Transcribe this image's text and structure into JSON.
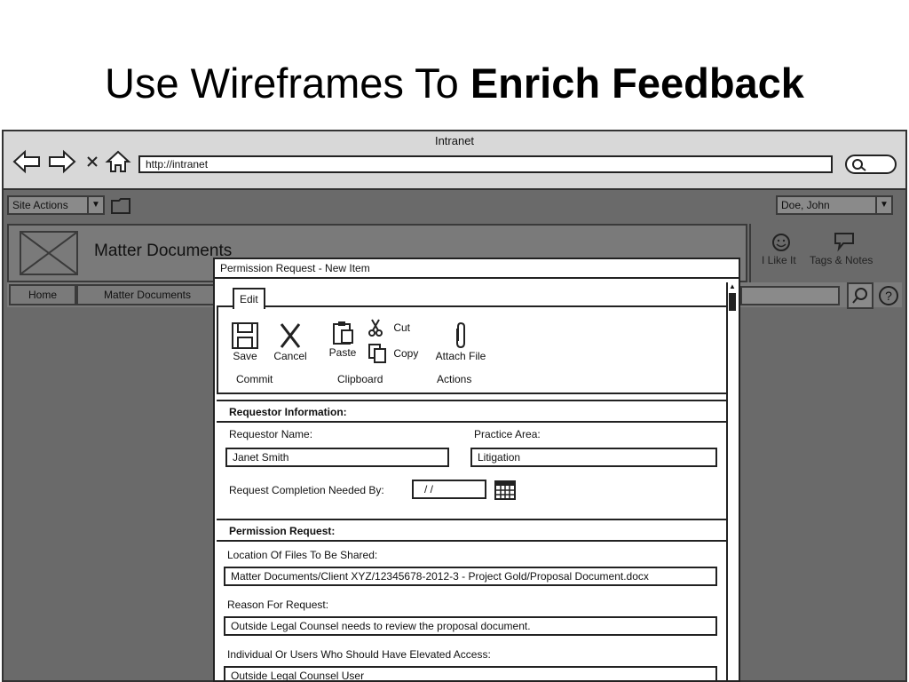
{
  "slide": {
    "title_plain": "Use Wireframes To ",
    "title_bold": "Enrich Feedback"
  },
  "browser": {
    "window_title": "Intranet",
    "url": "http://intranet"
  },
  "page": {
    "site_actions": "Site Actions",
    "user": "Doe, John",
    "site_name": "Matter Documents",
    "like_label": "I Like It",
    "tags_label": "Tags & Notes",
    "nav": [
      "Home",
      "Matter Documents"
    ]
  },
  "dialog": {
    "title": "Permission Request - New Item",
    "tab": "Edit",
    "buttons": {
      "save": "Save",
      "cancel": "Cancel",
      "paste": "Paste",
      "cut": "Cut",
      "copy": "Copy",
      "attach": "Attach File"
    },
    "groups": {
      "commit": "Commit",
      "clipboard": "Clipboard",
      "actions": "Actions"
    },
    "requestor_section": "Requestor Information:",
    "requestor_name_label": "Requestor Name:",
    "requestor_name_value": "Janet Smith",
    "practice_area_label": "Practice Area:",
    "practice_area_value": "Litigation",
    "completion_label": "Request Completion Needed By:",
    "completion_value": "/ /",
    "permission_section": "Permission Request:",
    "location_label": "Location Of Files To Be Shared:",
    "location_value": "Matter Documents/Client XYZ/12345678-2012-3 - Project Gold/Proposal Document.docx",
    "reason_label": "Reason For Request:",
    "reason_value": "Outside Legal Counsel needs to review the proposal document.",
    "users_label": "Individual Or Users Who Should Have Elevated Access:",
    "users_value": "Outside Legal Counsel User"
  }
}
